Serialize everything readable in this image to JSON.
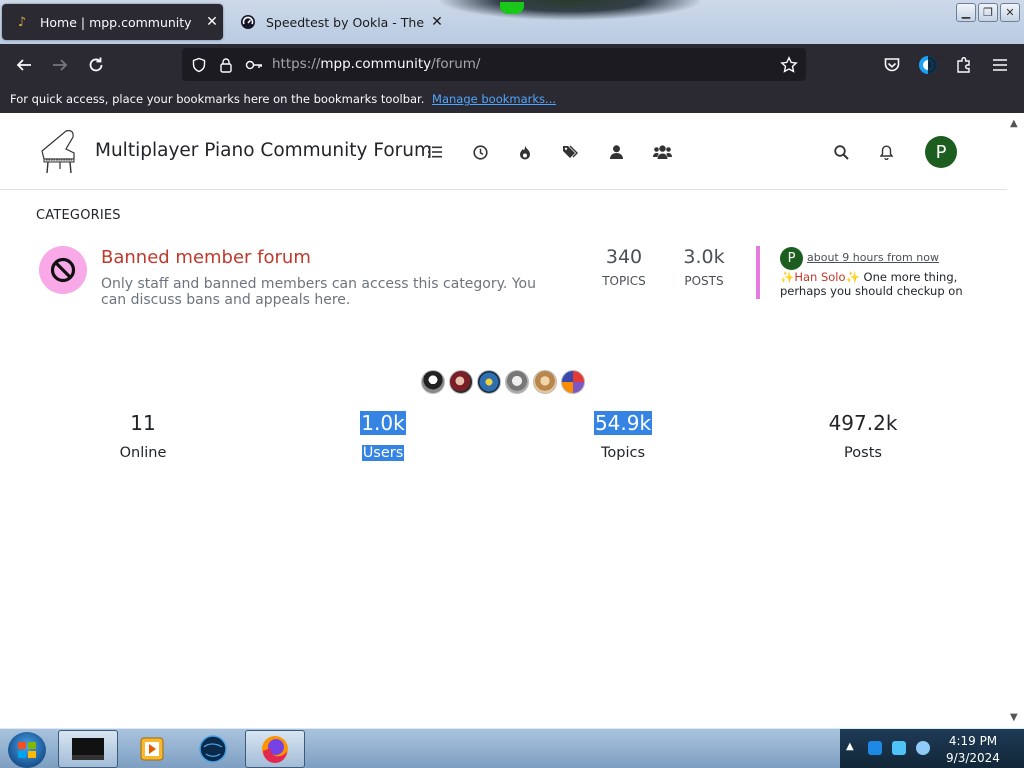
{
  "browser": {
    "tabs": [
      {
        "label": "Home | mpp.community",
        "icon": "music-note-icon",
        "active": true
      },
      {
        "label": "Speedtest by Ookla - The Glob",
        "icon": "speedtest-icon",
        "active": false
      }
    ],
    "url_scheme": "https://",
    "url_host": "mpp.community",
    "url_path": "/forum/",
    "bookmarks_text": "For quick access, place your bookmarks here on the bookmarks toolbar.",
    "bookmarks_link": "Manage bookmarks..."
  },
  "forum": {
    "site_title": "Multiplayer Piano Community Forum",
    "user_initial": "P",
    "nav_icons": [
      "list-icon",
      "clock-icon",
      "fire-icon",
      "tags-icon",
      "user-icon",
      "users-icon"
    ],
    "categories_heading": "CATEGORIES",
    "category": {
      "title": "Banned member forum",
      "description": "Only staff and banned members can access this category. You can discuss bans and appeals here.",
      "topics_count": "340",
      "topics_label": "TOPICS",
      "posts_count": "3.0k",
      "posts_label": "POSTS",
      "icon_color": "#f9a8e8",
      "title_color": "#c0392b"
    },
    "teaser": {
      "avatar_initial": "P",
      "time": "about 9 hours from now",
      "sparkle_left": "✨",
      "name": "Han Solo",
      "sparkle_right": "✨",
      "text": " One more thing, perhaps you should checkup on"
    },
    "stats": [
      {
        "value": "11",
        "label": "Online",
        "highlighted": false
      },
      {
        "value": "1.0k",
        "label": "Users",
        "highlighted": true
      },
      {
        "value": "54.9k",
        "label": "Topics",
        "highlighted": true
      },
      {
        "value": "497.2k",
        "label": "Posts",
        "highlighted": false
      }
    ]
  },
  "taskbar": {
    "time": "4:19 PM",
    "date": "9/3/2024"
  }
}
